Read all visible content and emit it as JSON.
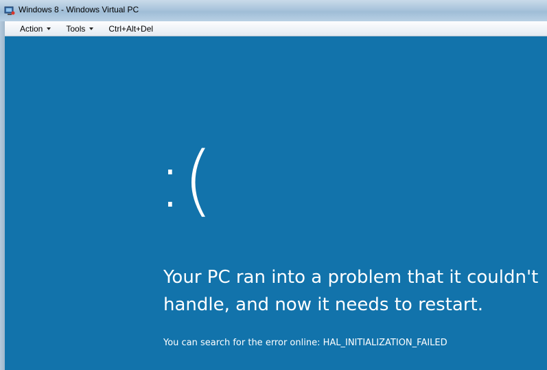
{
  "window": {
    "title": "Windows 8 - Windows Virtual PC",
    "icon": "virtual-pc-icon"
  },
  "menu": {
    "items": [
      {
        "label": "Action",
        "has_dropdown": true
      },
      {
        "label": "Tools",
        "has_dropdown": true
      },
      {
        "label": "Ctrl+Alt+Del",
        "has_dropdown": false
      }
    ]
  },
  "bsod": {
    "face": ":(",
    "message": "Your PC ran into a problem that it couldn't handle, and now it needs to restart.",
    "detail": "You can search for the error online: HAL_INITIALIZATION_FAILED",
    "background_color": "#1273ab"
  }
}
